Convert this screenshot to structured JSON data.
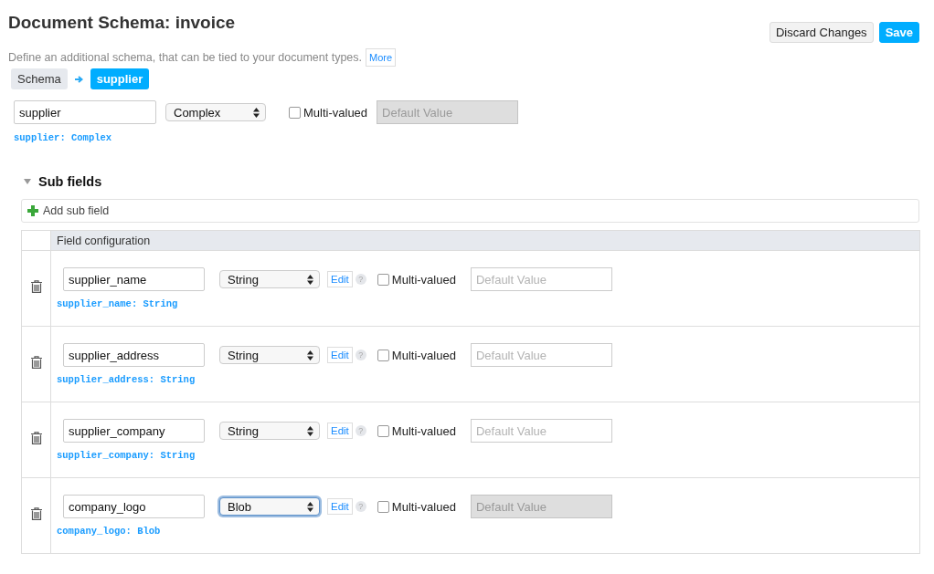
{
  "title": "Document Schema: invoice",
  "actions": [
    {
      "label": "Discard Changes",
      "kind": "secondary"
    },
    {
      "label": "Save",
      "kind": "primary"
    }
  ],
  "description": "Define an additional schema, that can be tied to your document types.",
  "more_link": "More",
  "breadcrumb": [
    {
      "label": "Schema",
      "selected": false
    },
    {
      "label": "supplier",
      "selected": true
    }
  ],
  "field": {
    "name": "supplier",
    "type": "Complex",
    "type_focused": false,
    "multi_valued_label": "Multi-valued",
    "multi_valued": false,
    "default_placeholder": "Default Value",
    "default_disabled": true,
    "signature": "supplier: Complex"
  },
  "sub_fields": {
    "heading": "Sub fields",
    "expanded": true,
    "add_label": "Add sub field",
    "column_header": "Field configuration",
    "rows": [
      {
        "name": "supplier_name",
        "type": "String",
        "type_focused": false,
        "edit": "Edit",
        "help": "?",
        "multi_valued_label": "Multi-valued",
        "multi_valued": false,
        "default_placeholder": "Default Value",
        "default_disabled": false,
        "signature": "supplier_name: String"
      },
      {
        "name": "supplier_address",
        "type": "String",
        "type_focused": false,
        "edit": "Edit",
        "help": "?",
        "multi_valued_label": "Multi-valued",
        "multi_valued": false,
        "default_placeholder": "Default Value",
        "default_disabled": false,
        "signature": "supplier_address: String"
      },
      {
        "name": "supplier_company",
        "type": "String",
        "type_focused": false,
        "edit": "Edit",
        "help": "?",
        "multi_valued_label": "Multi-valued",
        "multi_valued": false,
        "default_placeholder": "Default Value",
        "default_disabled": false,
        "signature": "supplier_company: String"
      },
      {
        "name": "company_logo",
        "type": "Blob",
        "type_focused": true,
        "edit": "Edit",
        "help": "?",
        "multi_valued_label": "Multi-valued",
        "multi_valued": false,
        "default_placeholder": "Default Value",
        "default_disabled": true,
        "signature": "company_logo: Blob"
      }
    ]
  }
}
